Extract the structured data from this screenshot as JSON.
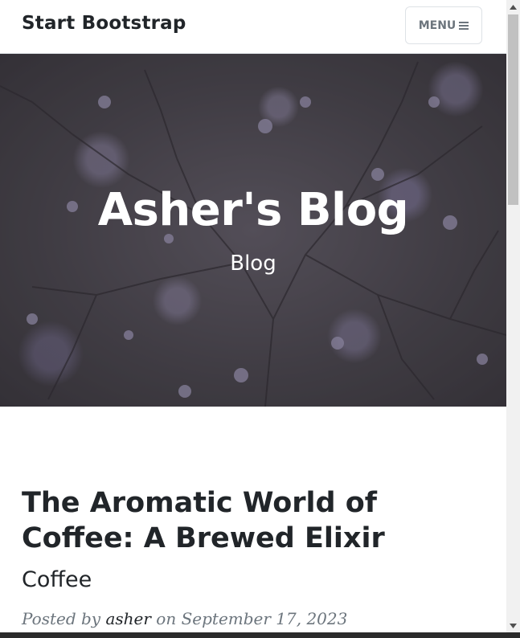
{
  "navbar": {
    "brand": "Start Bootstrap",
    "menu_label": "MENU",
    "menu_icon": "hamburger-icon"
  },
  "hero": {
    "title": "Asher's Blog",
    "subtitle": "Blog"
  },
  "post": {
    "title": "The Aromatic World of Coffee: A Brewed Elixir",
    "subtitle": "Coffee",
    "meta_prefix": "Posted by",
    "author": "asher",
    "meta_on": "on",
    "date": "September 17, 2023"
  },
  "scrollbar": {
    "up_icon": "scroll-up-arrow-icon",
    "down_icon": "scroll-down-arrow-icon"
  },
  "colors": {
    "text_dark": "#212529",
    "text_muted": "#6c757d",
    "hero_text": "#ffffff"
  }
}
